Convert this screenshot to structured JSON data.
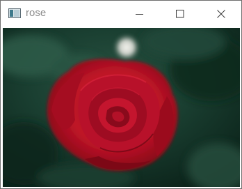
{
  "window": {
    "title": "rose",
    "controls": {
      "minimize_icon": "minimize-icon",
      "maximize_icon": "maximize-icon",
      "close_icon": "close-icon"
    }
  },
  "image": {
    "subject_icon": "rose-photo",
    "colors": {
      "petal": "#b30c22",
      "petal_dark": "#6e0613",
      "background": "#16382a",
      "highlight": "#e9e9e2"
    }
  }
}
